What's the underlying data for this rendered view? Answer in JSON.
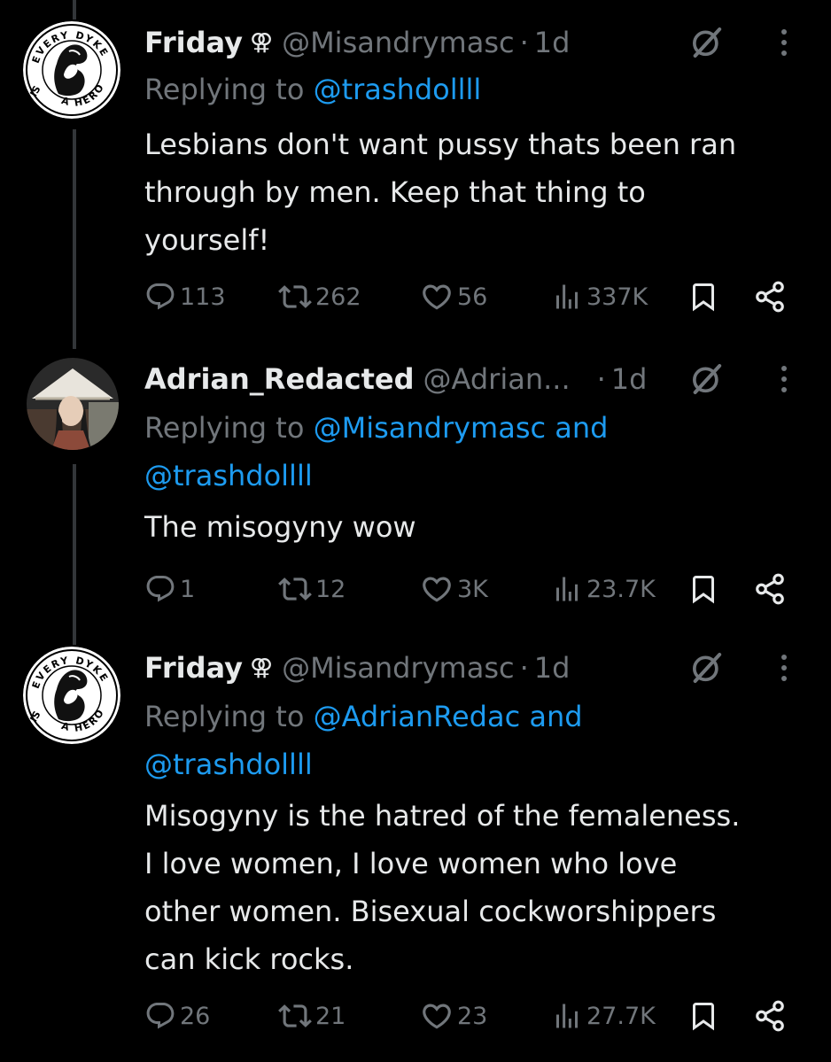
{
  "tweets": [
    {
      "name": "Friday",
      "name_symbol": "⚢",
      "handle": "@Misandrymasc",
      "time": "1d",
      "reply_prefix": "Replying to ",
      "reply_line1_mention": "@trashdollll",
      "reply_line1_suffix": "",
      "reply_line2": "",
      "text": "Lesbians don't want pussy thats been ran\nthrough by men. Keep that thing to\nyourself!",
      "replies": "113",
      "reposts": "262",
      "likes": "56",
      "views": "337K"
    },
    {
      "name": "Adrian_Redacted",
      "name_symbol": "",
      "handle": "@Adrian...",
      "time": "1d",
      "reply_prefix": "Replying to ",
      "reply_line1_mention": "@Misandrymasc",
      "reply_line1_suffix": " and",
      "reply_line2": "@trashdollll",
      "text": "The misogyny wow",
      "replies": "1",
      "reposts": "12",
      "likes": "3K",
      "views": "23.7K"
    },
    {
      "name": "Friday",
      "name_symbol": "⚢",
      "handle": "@Misandrymasc",
      "time": "1d",
      "reply_prefix": "Replying to ",
      "reply_line1_mention": "@AdrianRedac",
      "reply_line1_suffix": " and",
      "reply_line2": "@trashdollll",
      "text": "Misogyny is the hatred of the femaleness.\nI love women, I love women who love\nother women. Bisexual cockworshippers\ncan kick rocks.",
      "replies": "26",
      "reposts": "21",
      "likes": "23",
      "views": "27.7K"
    }
  ],
  "avatar_logo_text": {
    "top": "EVERY DYKE",
    "left": "IS",
    "bottom": "A HERO"
  },
  "icons": {
    "reply": "reply-icon",
    "repost": "repost-icon",
    "like": "heart-icon",
    "views": "views-icon",
    "bookmark": "bookmark-icon",
    "share": "share-icon",
    "grok": "grok-icon",
    "more": "more-icon"
  },
  "colors": {
    "background": "#000000",
    "text_primary": "#e7e9ea",
    "text_secondary": "#71767b",
    "link": "#1d9bf0",
    "thread_line": "#333639"
  }
}
